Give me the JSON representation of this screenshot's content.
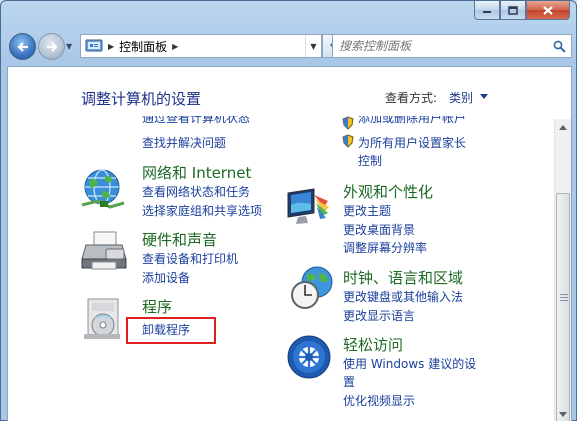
{
  "window": {
    "buttons": {
      "minimize": "minimize",
      "maximize": "maximize",
      "close": "close"
    }
  },
  "address_bar": {
    "crumbs": [
      "控制面板"
    ],
    "icon": "control-panel-icon"
  },
  "search": {
    "placeholder": "搜索控制面板"
  },
  "content": {
    "title": "调整计算机的设置",
    "view_by_label": "查看方式:",
    "view_by_value": "类别",
    "left_column": [
      {
        "id": "system-security",
        "icon": "shield-flag-icon",
        "partial_link": "通过查看计算机状态",
        "links": [
          "查找并解决问题"
        ]
      },
      {
        "id": "network",
        "icon": "network-globe-icon",
        "heading": "网络和 Internet",
        "links": [
          "查看网络状态和任务",
          "选择家庭组和共享选项"
        ]
      },
      {
        "id": "hardware",
        "icon": "printer-icon",
        "heading": "硬件和声音",
        "links": [
          "查看设备和打印机",
          "添加设备"
        ]
      },
      {
        "id": "programs",
        "icon": "programs-disc-icon",
        "heading": "程序",
        "links": [
          "卸载程序"
        ]
      }
    ],
    "right_column": [
      {
        "id": "user-accounts",
        "partial_link": "添加或删除用户帐户",
        "links": [
          "为所有用户设置家长",
          "控制"
        ]
      },
      {
        "id": "appearance",
        "icon": "appearance-monitor-icon",
        "heading": "外观和个性化",
        "links": [
          "更改主题",
          "更改桌面背景",
          "调整屏幕分辨率"
        ]
      },
      {
        "id": "clock",
        "icon": "clock-globe-icon",
        "heading": "时钟、语言和区域",
        "links": [
          "更改键盘或其他输入法",
          "更改显示语言"
        ]
      },
      {
        "id": "ease",
        "icon": "ease-of-access-icon",
        "heading": "轻松访问",
        "links": [
          "使用 Windows 建议的设",
          "置",
          "优化视频显示"
        ]
      }
    ]
  },
  "colors": {
    "heading_green": "#1c6a23",
    "link_blue": "#1a3f9c",
    "title_blue": "#1e3287",
    "highlight_red": "#e0201f"
  }
}
